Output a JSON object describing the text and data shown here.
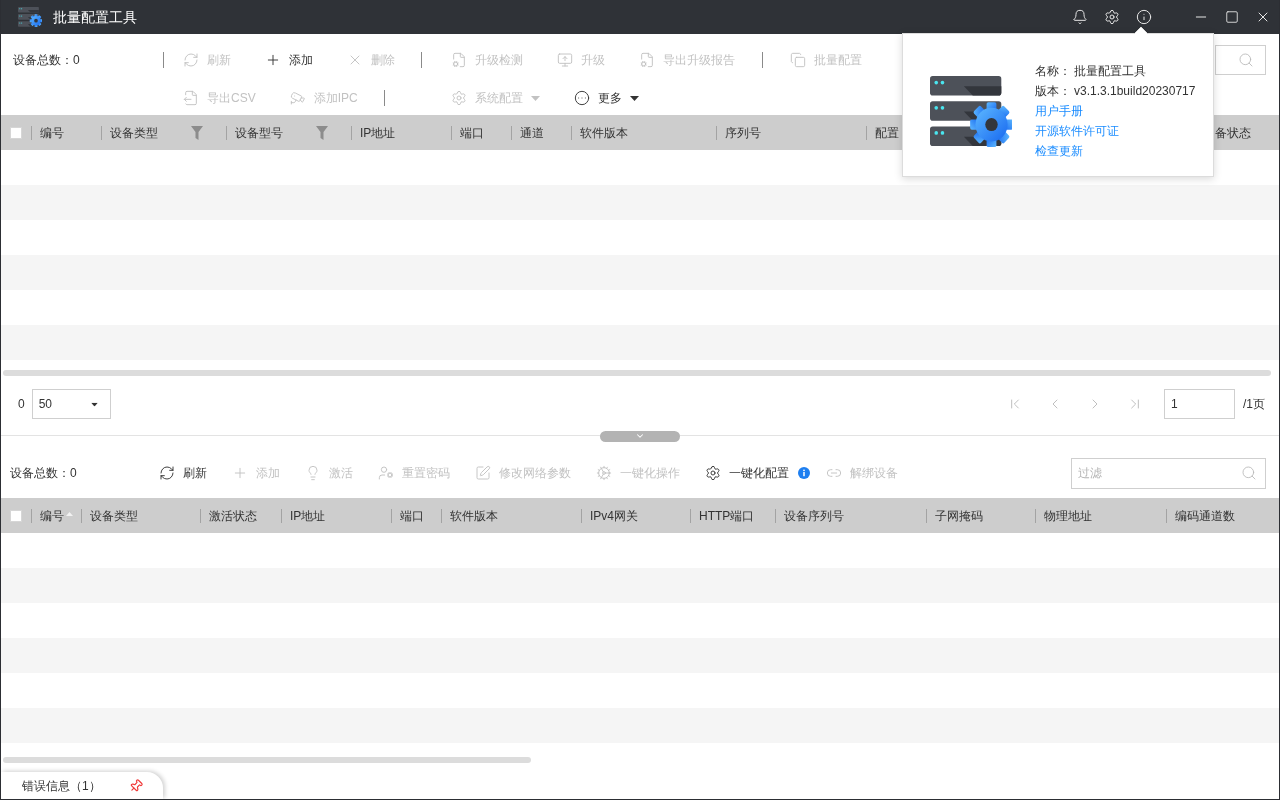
{
  "window": {
    "title": "批量配置工具"
  },
  "top_toolbar": {
    "device_count": "设备总数：0",
    "rows": [
      {
        "groups": [
          {
            "buttons": [
              {
                "label": "刷新",
                "kind": "button",
                "disabled": true
              },
              {
                "label": "添加",
                "kind": "button",
                "disabled": false
              },
              {
                "label": "删除",
                "kind": "button",
                "disabled": true
              }
            ]
          },
          {
            "buttons": [
              {
                "label": "升级检测",
                "kind": "button",
                "disabled": true
              },
              {
                "label": "升级",
                "kind": "button",
                "disabled": true
              },
              {
                "label": "导出升级报告",
                "kind": "button",
                "disabled": true
              }
            ]
          },
          {
            "buttons": [
              {
                "label": "批量配置",
                "kind": "button",
                "disabled": true
              }
            ]
          }
        ]
      },
      {
        "groups": [
          {
            "buttons": [
              {
                "label": "导出CSV",
                "kind": "button",
                "disabled": true
              },
              {
                "label": "添加IPC",
                "kind": "button",
                "disabled": true
              }
            ]
          },
          {
            "buttons": [
              {
                "label": "系统配置",
                "kind": "dropdown",
                "disabled": true
              },
              {
                "label": "更多",
                "kind": "dropdown",
                "disabled": false
              }
            ]
          }
        ]
      }
    ]
  },
  "top_table": {
    "select_all_checked": false,
    "columns": [
      {
        "label": "编号",
        "filterable": false
      },
      {
        "label": "设备类型",
        "filterable": true
      },
      {
        "label": "设备型号",
        "filterable": true
      },
      {
        "label": "IP地址",
        "filterable": false
      },
      {
        "label": "端口",
        "filterable": false
      },
      {
        "label": "通道",
        "filterable": false
      },
      {
        "label": "软件版本",
        "filterable": false
      },
      {
        "label": "序列号",
        "filterable": false
      },
      {
        "label": "配置",
        "filterable": false
      },
      {
        "label": "备状态",
        "filterable": false
      }
    ]
  },
  "pager": {
    "total": "0",
    "page_size": "50",
    "page": "1",
    "page_count": "/1页"
  },
  "bottom_toolbar": {
    "device_count": "设备总数：0",
    "buttons": [
      {
        "label": "刷新",
        "disabled": false
      },
      {
        "label": "添加",
        "disabled": true
      },
      {
        "label": "激活",
        "disabled": true
      },
      {
        "label": "重置密码",
        "disabled": true
      },
      {
        "label": "修改网络参数",
        "disabled": true
      },
      {
        "label": "一键化操作",
        "disabled": true
      },
      {
        "label": "一键化配置",
        "disabled": false,
        "info": true
      },
      {
        "label": "解绑设备",
        "disabled": true
      }
    ],
    "filter": {
      "placeholder": "过滤"
    }
  },
  "bottom_table": {
    "select_all_checked": false,
    "columns": [
      {
        "label": "编号",
        "sorted": true
      },
      {
        "label": "设备类型",
        "sorted": false
      },
      {
        "label": "激活状态",
        "sorted": false
      },
      {
        "label": "IP地址",
        "sorted": false
      },
      {
        "label": "端口",
        "sorted": false
      },
      {
        "label": "软件版本",
        "sorted": false
      },
      {
        "label": "IPv4网关",
        "sorted": false
      },
      {
        "label": "HTTP端口",
        "sorted": false
      },
      {
        "label": "设备序列号",
        "sorted": false
      },
      {
        "label": "子网掩码",
        "sorted": false
      },
      {
        "label": "物理地址",
        "sorted": false
      },
      {
        "label": "编码通道数",
        "sorted": false
      }
    ]
  },
  "bottom_tabs": [
    {
      "label": "错误信息（1）",
      "pinned": true
    }
  ],
  "about_popup": {
    "fields": [
      {
        "label": "名称：",
        "value": "批量配置工具"
      },
      {
        "label": "版本：",
        "value": "v3.1.3.1build20230717"
      }
    ],
    "links": [
      "用户手册",
      "开源软件许可证",
      "检查更新"
    ]
  }
}
